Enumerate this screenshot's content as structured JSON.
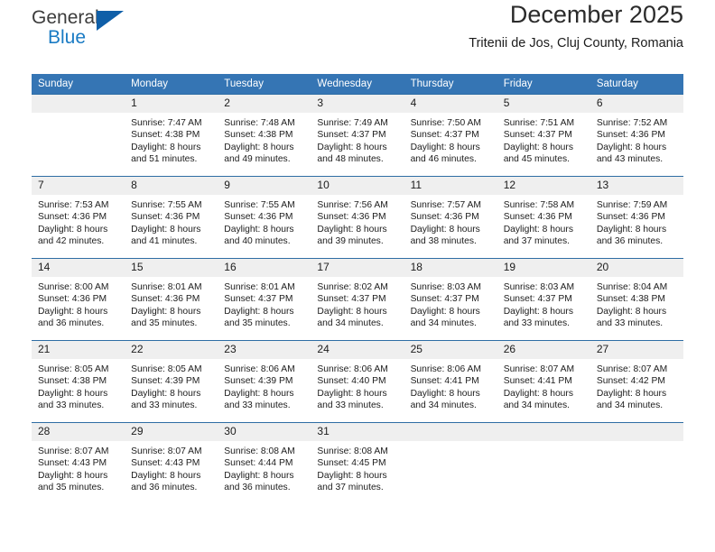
{
  "logo": {
    "word1": "General",
    "word2": "Blue",
    "accent_color": "#1a7bc4",
    "triangle_color": "#0f5fa8"
  },
  "header": {
    "month_title": "December 2025",
    "location": "Tritenii de Jos, Cluj County, Romania"
  },
  "calendar": {
    "header_bg": "#3575b4",
    "header_text_color": "#ffffff",
    "daynum_bg": "#efefef",
    "row_border_color": "#2e6da4",
    "weekday_headers": [
      "Sunday",
      "Monday",
      "Tuesday",
      "Wednesday",
      "Thursday",
      "Friday",
      "Saturday"
    ],
    "weeks": [
      [
        {
          "day": "",
          "lines": []
        },
        {
          "day": "1",
          "lines": [
            "Sunrise: 7:47 AM",
            "Sunset: 4:38 PM",
            "Daylight: 8 hours",
            "and 51 minutes."
          ]
        },
        {
          "day": "2",
          "lines": [
            "Sunrise: 7:48 AM",
            "Sunset: 4:38 PM",
            "Daylight: 8 hours",
            "and 49 minutes."
          ]
        },
        {
          "day": "3",
          "lines": [
            "Sunrise: 7:49 AM",
            "Sunset: 4:37 PM",
            "Daylight: 8 hours",
            "and 48 minutes."
          ]
        },
        {
          "day": "4",
          "lines": [
            "Sunrise: 7:50 AM",
            "Sunset: 4:37 PM",
            "Daylight: 8 hours",
            "and 46 minutes."
          ]
        },
        {
          "day": "5",
          "lines": [
            "Sunrise: 7:51 AM",
            "Sunset: 4:37 PM",
            "Daylight: 8 hours",
            "and 45 minutes."
          ]
        },
        {
          "day": "6",
          "lines": [
            "Sunrise: 7:52 AM",
            "Sunset: 4:36 PM",
            "Daylight: 8 hours",
            "and 43 minutes."
          ]
        }
      ],
      [
        {
          "day": "7",
          "lines": [
            "Sunrise: 7:53 AM",
            "Sunset: 4:36 PM",
            "Daylight: 8 hours",
            "and 42 minutes."
          ]
        },
        {
          "day": "8",
          "lines": [
            "Sunrise: 7:55 AM",
            "Sunset: 4:36 PM",
            "Daylight: 8 hours",
            "and 41 minutes."
          ]
        },
        {
          "day": "9",
          "lines": [
            "Sunrise: 7:55 AM",
            "Sunset: 4:36 PM",
            "Daylight: 8 hours",
            "and 40 minutes."
          ]
        },
        {
          "day": "10",
          "lines": [
            "Sunrise: 7:56 AM",
            "Sunset: 4:36 PM",
            "Daylight: 8 hours",
            "and 39 minutes."
          ]
        },
        {
          "day": "11",
          "lines": [
            "Sunrise: 7:57 AM",
            "Sunset: 4:36 PM",
            "Daylight: 8 hours",
            "and 38 minutes."
          ]
        },
        {
          "day": "12",
          "lines": [
            "Sunrise: 7:58 AM",
            "Sunset: 4:36 PM",
            "Daylight: 8 hours",
            "and 37 minutes."
          ]
        },
        {
          "day": "13",
          "lines": [
            "Sunrise: 7:59 AM",
            "Sunset: 4:36 PM",
            "Daylight: 8 hours",
            "and 36 minutes."
          ]
        }
      ],
      [
        {
          "day": "14",
          "lines": [
            "Sunrise: 8:00 AM",
            "Sunset: 4:36 PM",
            "Daylight: 8 hours",
            "and 36 minutes."
          ]
        },
        {
          "day": "15",
          "lines": [
            "Sunrise: 8:01 AM",
            "Sunset: 4:36 PM",
            "Daylight: 8 hours",
            "and 35 minutes."
          ]
        },
        {
          "day": "16",
          "lines": [
            "Sunrise: 8:01 AM",
            "Sunset: 4:37 PM",
            "Daylight: 8 hours",
            "and 35 minutes."
          ]
        },
        {
          "day": "17",
          "lines": [
            "Sunrise: 8:02 AM",
            "Sunset: 4:37 PM",
            "Daylight: 8 hours",
            "and 34 minutes."
          ]
        },
        {
          "day": "18",
          "lines": [
            "Sunrise: 8:03 AM",
            "Sunset: 4:37 PM",
            "Daylight: 8 hours",
            "and 34 minutes."
          ]
        },
        {
          "day": "19",
          "lines": [
            "Sunrise: 8:03 AM",
            "Sunset: 4:37 PM",
            "Daylight: 8 hours",
            "and 33 minutes."
          ]
        },
        {
          "day": "20",
          "lines": [
            "Sunrise: 8:04 AM",
            "Sunset: 4:38 PM",
            "Daylight: 8 hours",
            "and 33 minutes."
          ]
        }
      ],
      [
        {
          "day": "21",
          "lines": [
            "Sunrise: 8:05 AM",
            "Sunset: 4:38 PM",
            "Daylight: 8 hours",
            "and 33 minutes."
          ]
        },
        {
          "day": "22",
          "lines": [
            "Sunrise: 8:05 AM",
            "Sunset: 4:39 PM",
            "Daylight: 8 hours",
            "and 33 minutes."
          ]
        },
        {
          "day": "23",
          "lines": [
            "Sunrise: 8:06 AM",
            "Sunset: 4:39 PM",
            "Daylight: 8 hours",
            "and 33 minutes."
          ]
        },
        {
          "day": "24",
          "lines": [
            "Sunrise: 8:06 AM",
            "Sunset: 4:40 PM",
            "Daylight: 8 hours",
            "and 33 minutes."
          ]
        },
        {
          "day": "25",
          "lines": [
            "Sunrise: 8:06 AM",
            "Sunset: 4:41 PM",
            "Daylight: 8 hours",
            "and 34 minutes."
          ]
        },
        {
          "day": "26",
          "lines": [
            "Sunrise: 8:07 AM",
            "Sunset: 4:41 PM",
            "Daylight: 8 hours",
            "and 34 minutes."
          ]
        },
        {
          "day": "27",
          "lines": [
            "Sunrise: 8:07 AM",
            "Sunset: 4:42 PM",
            "Daylight: 8 hours",
            "and 34 minutes."
          ]
        }
      ],
      [
        {
          "day": "28",
          "lines": [
            "Sunrise: 8:07 AM",
            "Sunset: 4:43 PM",
            "Daylight: 8 hours",
            "and 35 minutes."
          ]
        },
        {
          "day": "29",
          "lines": [
            "Sunrise: 8:07 AM",
            "Sunset: 4:43 PM",
            "Daylight: 8 hours",
            "and 36 minutes."
          ]
        },
        {
          "day": "30",
          "lines": [
            "Sunrise: 8:08 AM",
            "Sunset: 4:44 PM",
            "Daylight: 8 hours",
            "and 36 minutes."
          ]
        },
        {
          "day": "31",
          "lines": [
            "Sunrise: 8:08 AM",
            "Sunset: 4:45 PM",
            "Daylight: 8 hours",
            "and 37 minutes."
          ]
        },
        {
          "day": "",
          "lines": []
        },
        {
          "day": "",
          "lines": []
        },
        {
          "day": "",
          "lines": []
        }
      ]
    ]
  }
}
